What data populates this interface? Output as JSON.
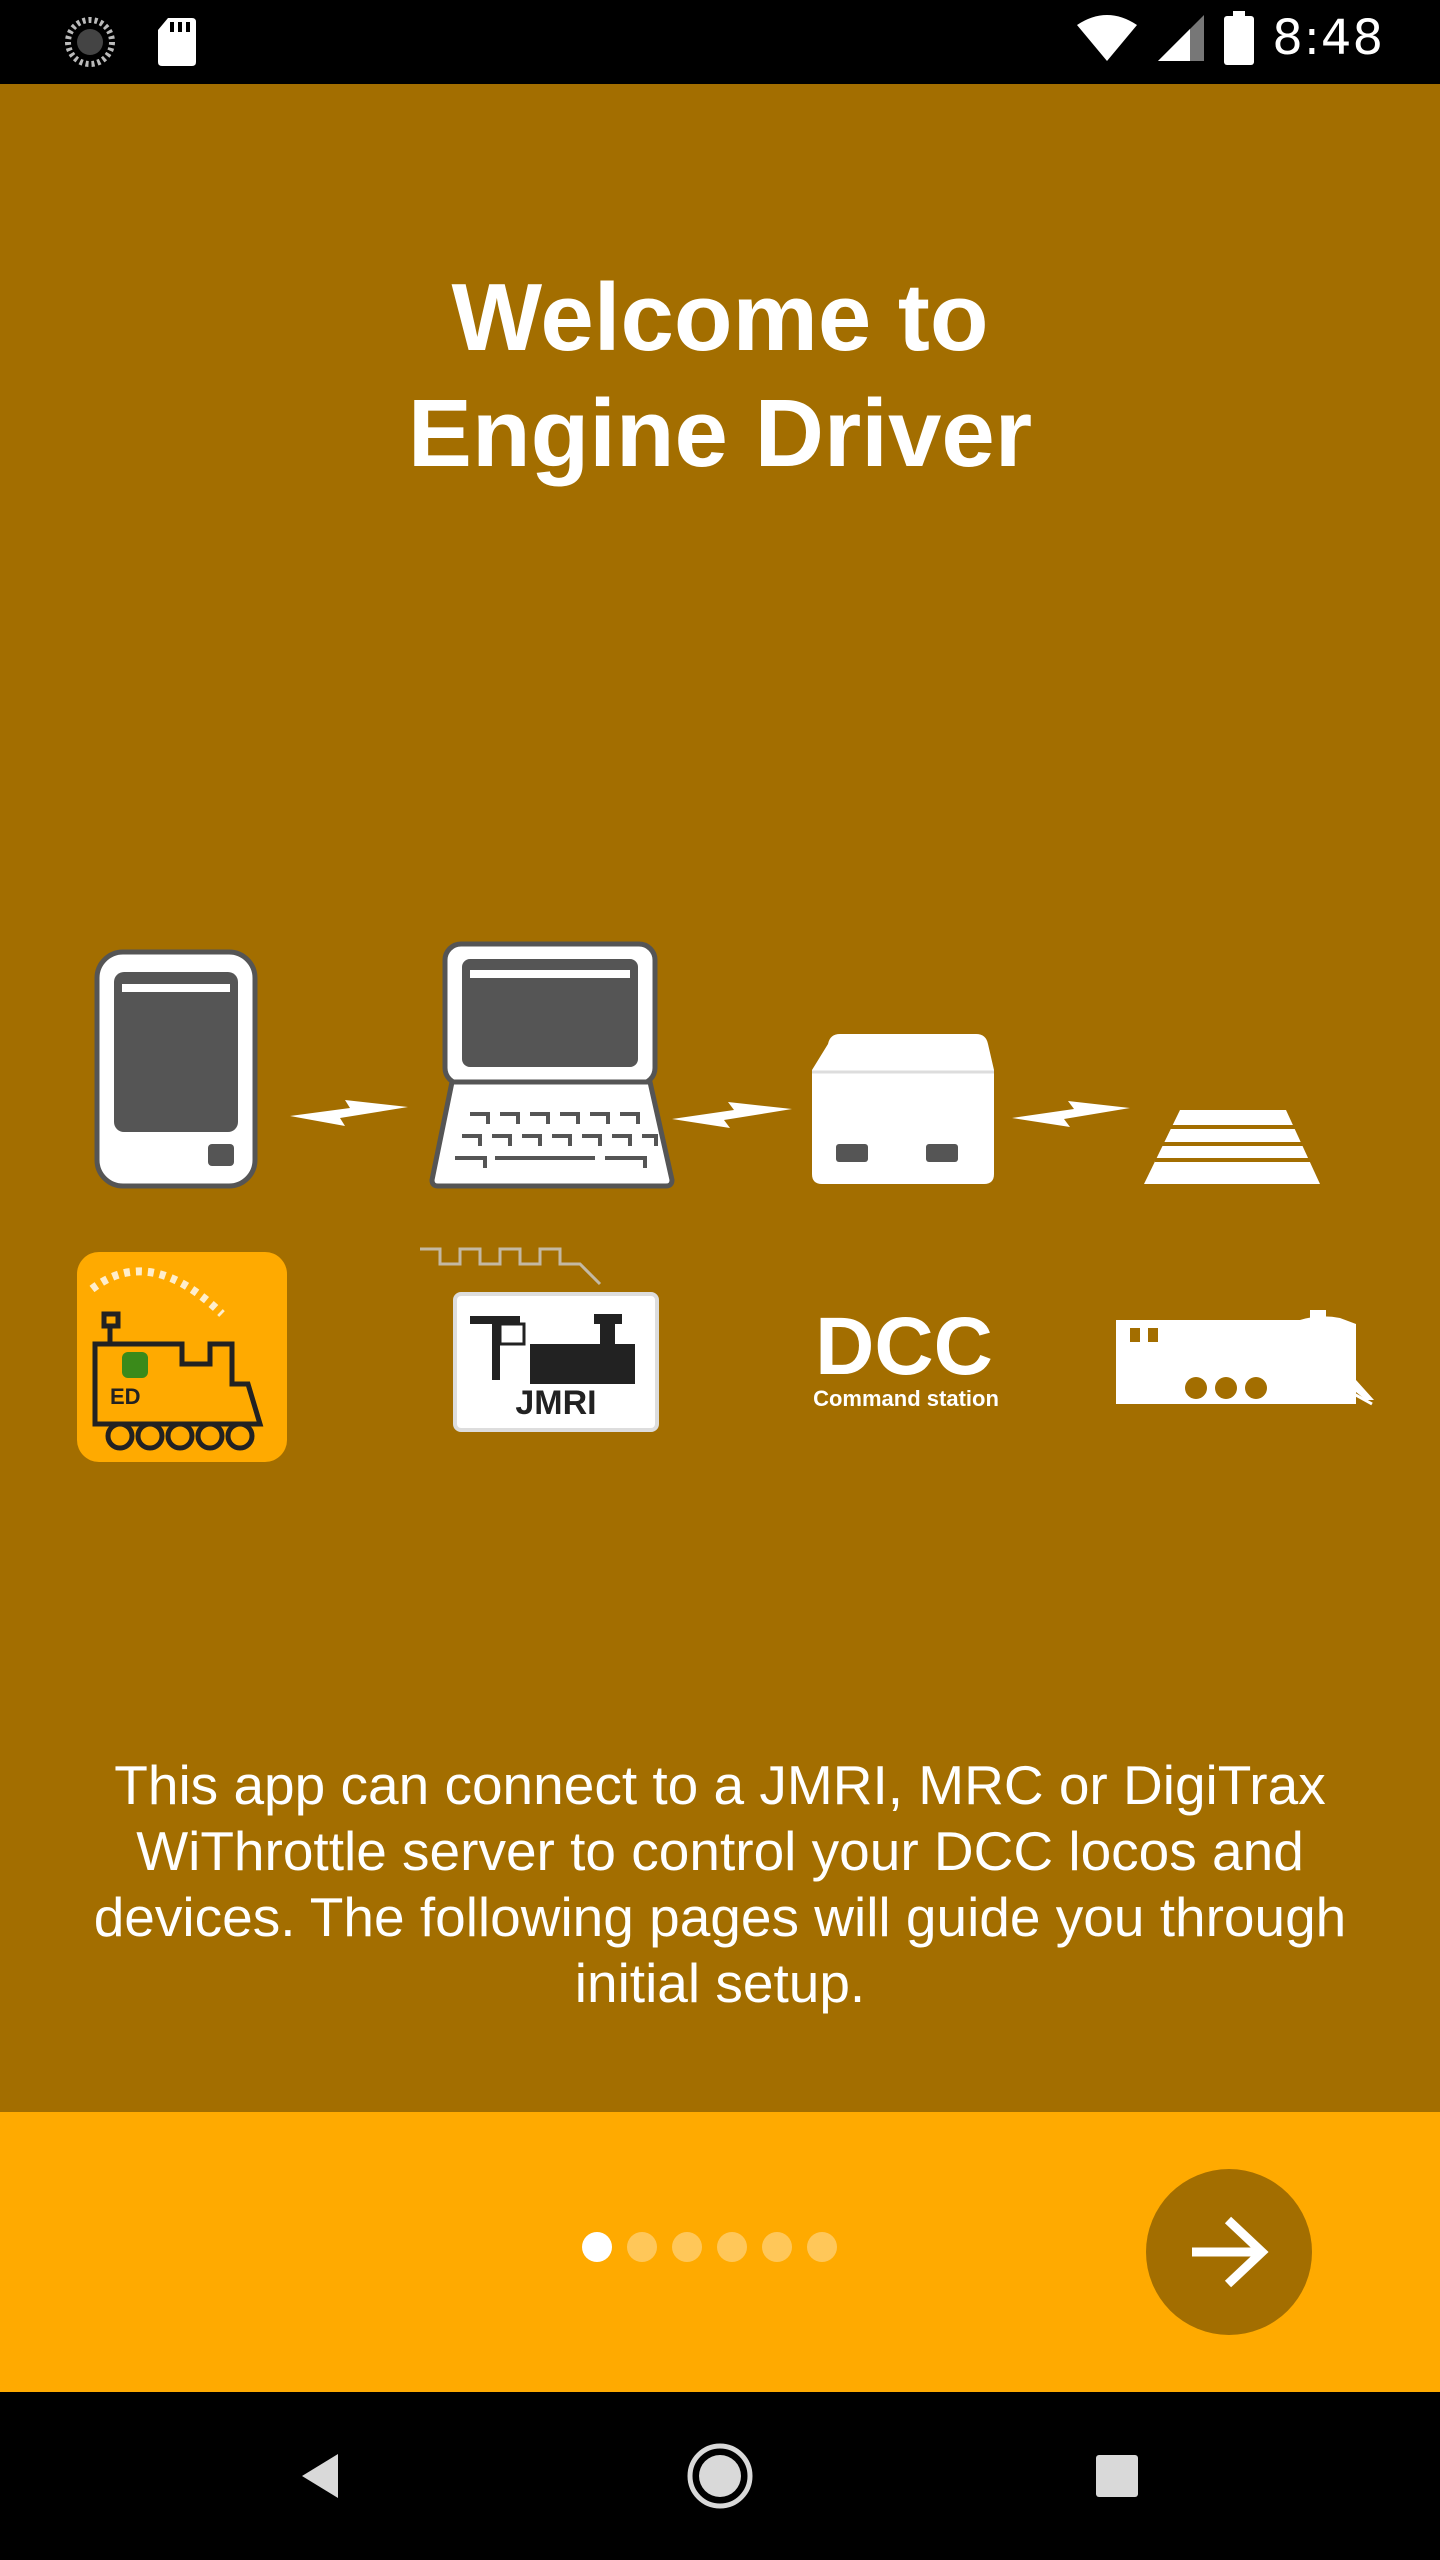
{
  "status_bar": {
    "time": "8:48",
    "icons": [
      "sync-icon",
      "sd-card-icon",
      "wifi-icon",
      "cell-signal-icon",
      "battery-icon"
    ]
  },
  "welcome": {
    "title_line1": "Welcome to",
    "title_line2": "Engine Driver",
    "description": "This app can connect to a JMRI, MRC or DigiTrax WiThrottle server to control your DCC locos and devices. The following pages will guide you through initial setup."
  },
  "illustration": {
    "devices": [
      "phone-icon",
      "computer-icon",
      "command-station-icon",
      "track-icon"
    ],
    "labels": {
      "ed": "ED",
      "jmri": "JMRI",
      "dcc": "DCC",
      "command_station": "Command station"
    }
  },
  "pager": {
    "page_count": 6,
    "current_page": 1
  },
  "navigation": {
    "next_icon": "arrow-right-icon",
    "system_buttons": [
      "back-icon",
      "home-icon",
      "recents-icon"
    ]
  },
  "colors": {
    "background": "#A36E00",
    "footer": "#FFAA00",
    "next_button": "#A36E00",
    "text": "#FFFFFF"
  }
}
